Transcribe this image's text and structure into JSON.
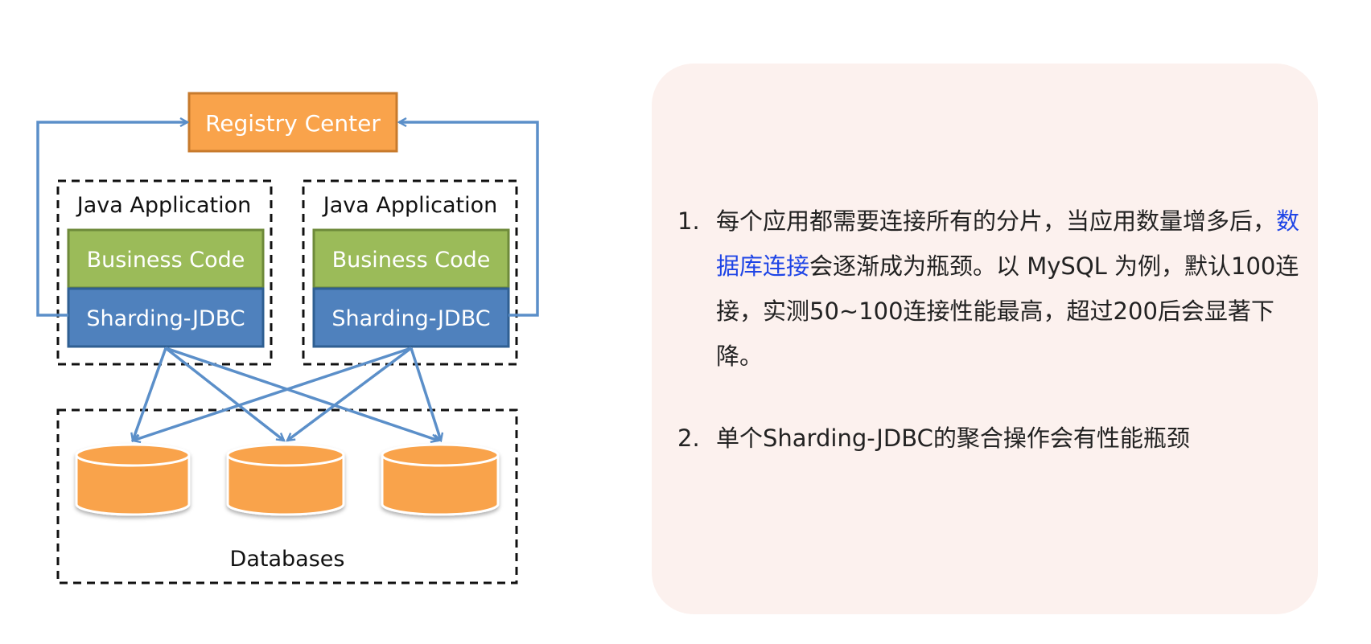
{
  "diagram": {
    "registry_label": "Registry Center",
    "apps": [
      {
        "title": "Java Application",
        "business": "Business Code",
        "sharding": "Sharding-JDBC"
      },
      {
        "title": "Java Application",
        "business": "Business Code",
        "sharding": "Sharding-JDBC"
      }
    ],
    "databases_label": "Databases",
    "colors": {
      "registry_fill": "#f9a34b",
      "business_fill": "#9bbb59",
      "sharding_fill": "#4f81bd",
      "database_fill": "#f9a34b",
      "arrow": "#5b8fc9"
    }
  },
  "notes": {
    "items": [
      {
        "number": "1.",
        "lead": "每个应用都需要连接所有的分片，当应用数量增多后，",
        "highlight": "数据库连接",
        "rest": "会逐渐成为瓶颈。以 MySQL 为例，默认100连接，实测50~100连接性能最高，超过200后会显著下降。"
      },
      {
        "number": "2.",
        "text": "单个Sharding-JDBC的聚合操作会有性能瓶颈"
      }
    ],
    "colors": {
      "panel_bg": "#fcf1ee",
      "highlight": "#1f45e6"
    }
  }
}
